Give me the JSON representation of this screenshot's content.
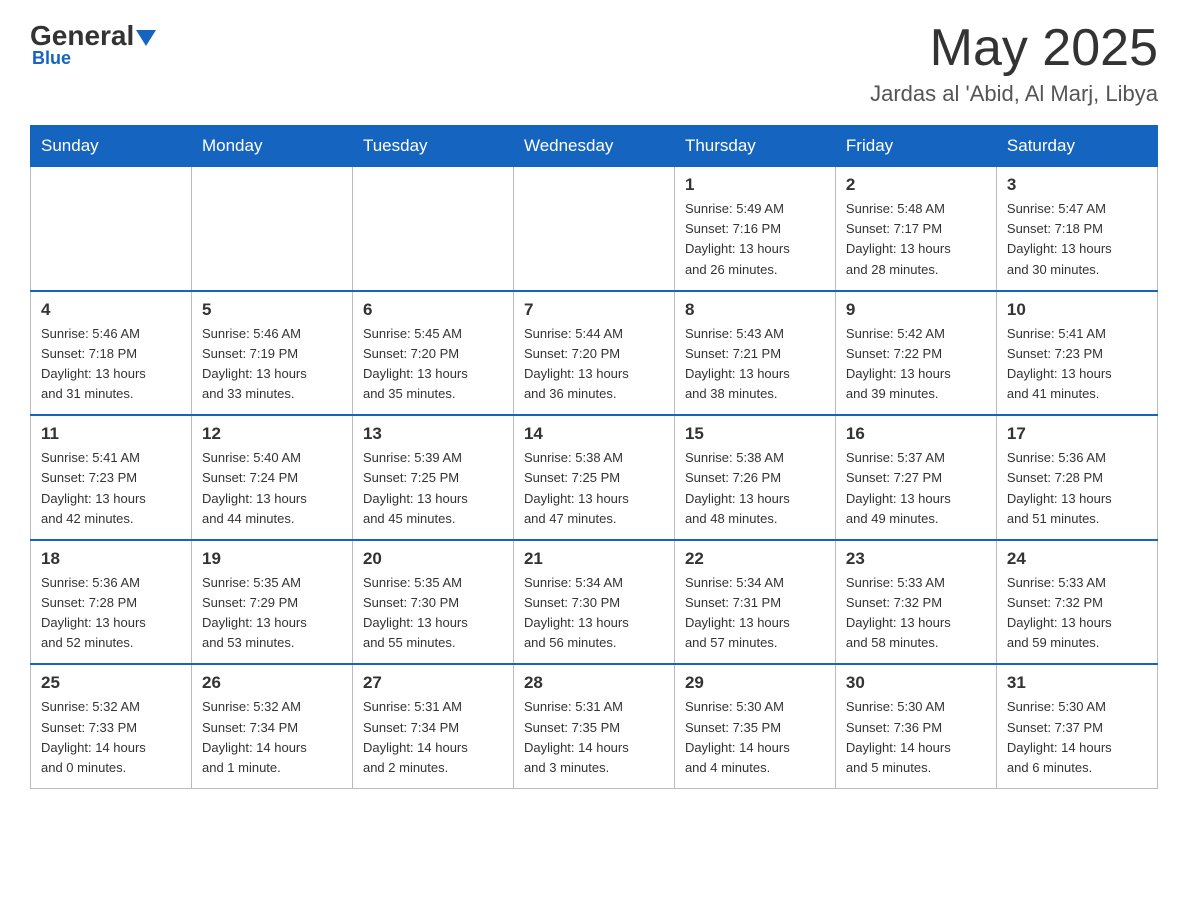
{
  "header": {
    "logo": {
      "general": "General",
      "arrow": "▲",
      "blue": "Blue"
    },
    "month": "May 2025",
    "location": "Jardas al 'Abid, Al Marj, Libya"
  },
  "days_of_week": [
    "Sunday",
    "Monday",
    "Tuesday",
    "Wednesday",
    "Thursday",
    "Friday",
    "Saturday"
  ],
  "weeks": [
    [
      {
        "day": "",
        "info": ""
      },
      {
        "day": "",
        "info": ""
      },
      {
        "day": "",
        "info": ""
      },
      {
        "day": "",
        "info": ""
      },
      {
        "day": "1",
        "info": "Sunrise: 5:49 AM\nSunset: 7:16 PM\nDaylight: 13 hours\nand 26 minutes."
      },
      {
        "day": "2",
        "info": "Sunrise: 5:48 AM\nSunset: 7:17 PM\nDaylight: 13 hours\nand 28 minutes."
      },
      {
        "day": "3",
        "info": "Sunrise: 5:47 AM\nSunset: 7:18 PM\nDaylight: 13 hours\nand 30 minutes."
      }
    ],
    [
      {
        "day": "4",
        "info": "Sunrise: 5:46 AM\nSunset: 7:18 PM\nDaylight: 13 hours\nand 31 minutes."
      },
      {
        "day": "5",
        "info": "Sunrise: 5:46 AM\nSunset: 7:19 PM\nDaylight: 13 hours\nand 33 minutes."
      },
      {
        "day": "6",
        "info": "Sunrise: 5:45 AM\nSunset: 7:20 PM\nDaylight: 13 hours\nand 35 minutes."
      },
      {
        "day": "7",
        "info": "Sunrise: 5:44 AM\nSunset: 7:20 PM\nDaylight: 13 hours\nand 36 minutes."
      },
      {
        "day": "8",
        "info": "Sunrise: 5:43 AM\nSunset: 7:21 PM\nDaylight: 13 hours\nand 38 minutes."
      },
      {
        "day": "9",
        "info": "Sunrise: 5:42 AM\nSunset: 7:22 PM\nDaylight: 13 hours\nand 39 minutes."
      },
      {
        "day": "10",
        "info": "Sunrise: 5:41 AM\nSunset: 7:23 PM\nDaylight: 13 hours\nand 41 minutes."
      }
    ],
    [
      {
        "day": "11",
        "info": "Sunrise: 5:41 AM\nSunset: 7:23 PM\nDaylight: 13 hours\nand 42 minutes."
      },
      {
        "day": "12",
        "info": "Sunrise: 5:40 AM\nSunset: 7:24 PM\nDaylight: 13 hours\nand 44 minutes."
      },
      {
        "day": "13",
        "info": "Sunrise: 5:39 AM\nSunset: 7:25 PM\nDaylight: 13 hours\nand 45 minutes."
      },
      {
        "day": "14",
        "info": "Sunrise: 5:38 AM\nSunset: 7:25 PM\nDaylight: 13 hours\nand 47 minutes."
      },
      {
        "day": "15",
        "info": "Sunrise: 5:38 AM\nSunset: 7:26 PM\nDaylight: 13 hours\nand 48 minutes."
      },
      {
        "day": "16",
        "info": "Sunrise: 5:37 AM\nSunset: 7:27 PM\nDaylight: 13 hours\nand 49 minutes."
      },
      {
        "day": "17",
        "info": "Sunrise: 5:36 AM\nSunset: 7:28 PM\nDaylight: 13 hours\nand 51 minutes."
      }
    ],
    [
      {
        "day": "18",
        "info": "Sunrise: 5:36 AM\nSunset: 7:28 PM\nDaylight: 13 hours\nand 52 minutes."
      },
      {
        "day": "19",
        "info": "Sunrise: 5:35 AM\nSunset: 7:29 PM\nDaylight: 13 hours\nand 53 minutes."
      },
      {
        "day": "20",
        "info": "Sunrise: 5:35 AM\nSunset: 7:30 PM\nDaylight: 13 hours\nand 55 minutes."
      },
      {
        "day": "21",
        "info": "Sunrise: 5:34 AM\nSunset: 7:30 PM\nDaylight: 13 hours\nand 56 minutes."
      },
      {
        "day": "22",
        "info": "Sunrise: 5:34 AM\nSunset: 7:31 PM\nDaylight: 13 hours\nand 57 minutes."
      },
      {
        "day": "23",
        "info": "Sunrise: 5:33 AM\nSunset: 7:32 PM\nDaylight: 13 hours\nand 58 minutes."
      },
      {
        "day": "24",
        "info": "Sunrise: 5:33 AM\nSunset: 7:32 PM\nDaylight: 13 hours\nand 59 minutes."
      }
    ],
    [
      {
        "day": "25",
        "info": "Sunrise: 5:32 AM\nSunset: 7:33 PM\nDaylight: 14 hours\nand 0 minutes."
      },
      {
        "day": "26",
        "info": "Sunrise: 5:32 AM\nSunset: 7:34 PM\nDaylight: 14 hours\nand 1 minute."
      },
      {
        "day": "27",
        "info": "Sunrise: 5:31 AM\nSunset: 7:34 PM\nDaylight: 14 hours\nand 2 minutes."
      },
      {
        "day": "28",
        "info": "Sunrise: 5:31 AM\nSunset: 7:35 PM\nDaylight: 14 hours\nand 3 minutes."
      },
      {
        "day": "29",
        "info": "Sunrise: 5:30 AM\nSunset: 7:35 PM\nDaylight: 14 hours\nand 4 minutes."
      },
      {
        "day": "30",
        "info": "Sunrise: 5:30 AM\nSunset: 7:36 PM\nDaylight: 14 hours\nand 5 minutes."
      },
      {
        "day": "31",
        "info": "Sunrise: 5:30 AM\nSunset: 7:37 PM\nDaylight: 14 hours\nand 6 minutes."
      }
    ]
  ]
}
